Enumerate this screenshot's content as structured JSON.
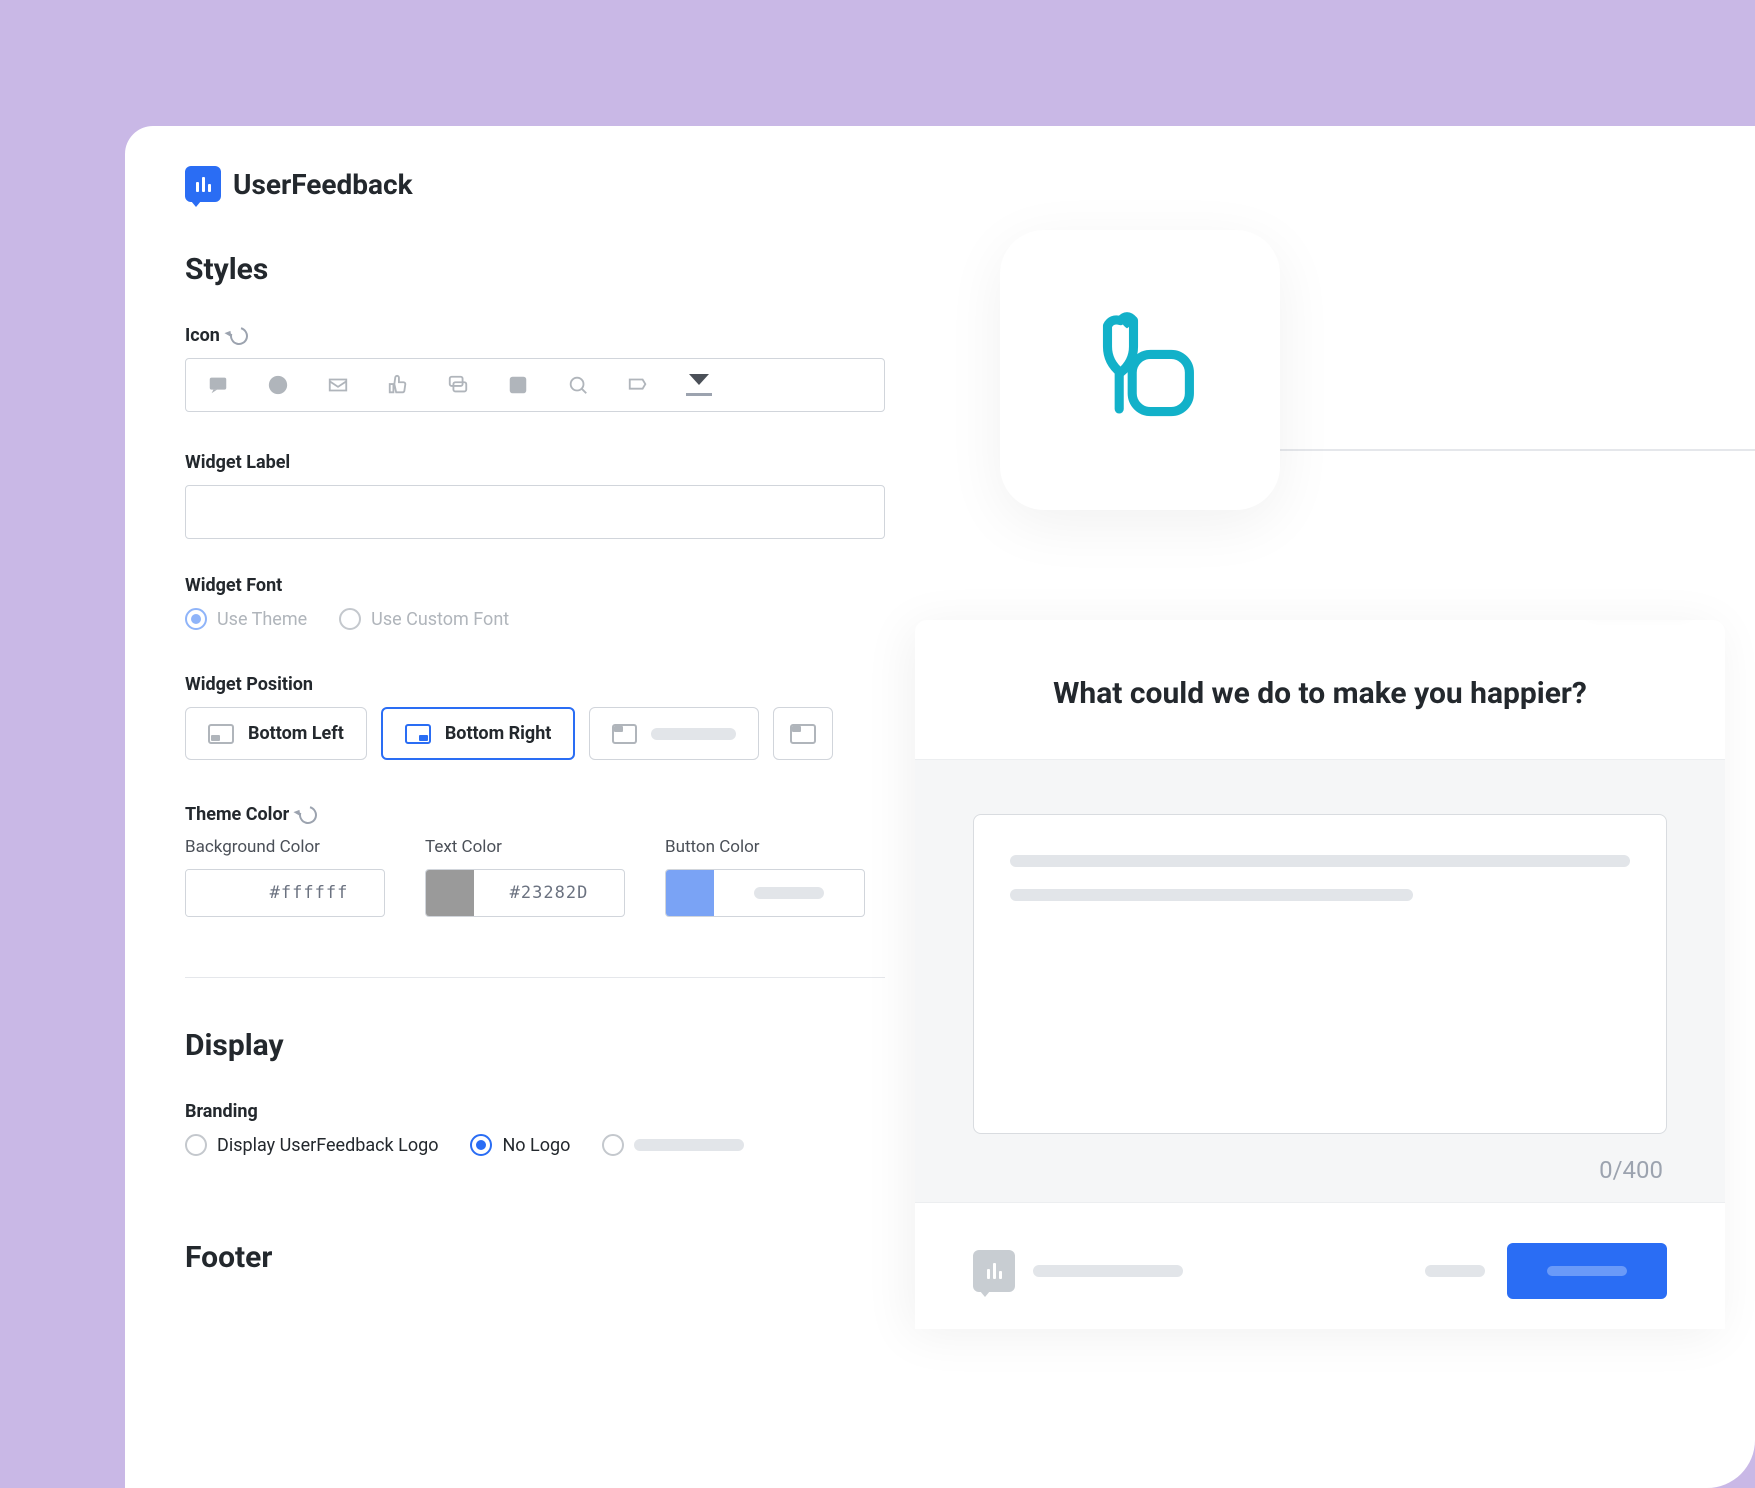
{
  "brand": {
    "name": "UserFeedback"
  },
  "sections": {
    "styles": {
      "title": "Styles",
      "icon": {
        "label": "Icon"
      },
      "widget_label": {
        "label": "Widget Label",
        "value": ""
      },
      "widget_font": {
        "label": "Widget Font",
        "options": [
          {
            "key": "theme",
            "label": "Use Theme",
            "checked": true
          },
          {
            "key": "custom",
            "label": "Use Custom Font",
            "checked": false
          }
        ]
      },
      "widget_position": {
        "label": "Widget Position",
        "options": [
          {
            "key": "bottom-left",
            "label": "Bottom Left",
            "selected": false
          },
          {
            "key": "bottom-right",
            "label": "Bottom Right",
            "selected": true
          }
        ]
      },
      "theme_color": {
        "label": "Theme Color",
        "background": {
          "label": "Background Color",
          "value": "#ffffff"
        },
        "text": {
          "label": "Text Color",
          "value": "#23282D"
        },
        "button": {
          "label": "Button Color",
          "value": "#7aa3f5"
        }
      }
    },
    "display": {
      "title": "Display",
      "branding": {
        "label": "Branding",
        "options": [
          {
            "key": "show-logo",
            "label": "Display UserFeedback Logo",
            "checked": false
          },
          {
            "key": "no-logo",
            "label": "No Logo",
            "checked": true
          }
        ]
      }
    },
    "footer": {
      "title": "Footer"
    }
  },
  "preview": {
    "question": "What could we do to make you happier?",
    "counter": "0/400"
  },
  "colors": {
    "accent": "#2a6df4",
    "text": "#23282D",
    "muted": "#b0b5bb",
    "paint_icon": "#12b1c9"
  }
}
